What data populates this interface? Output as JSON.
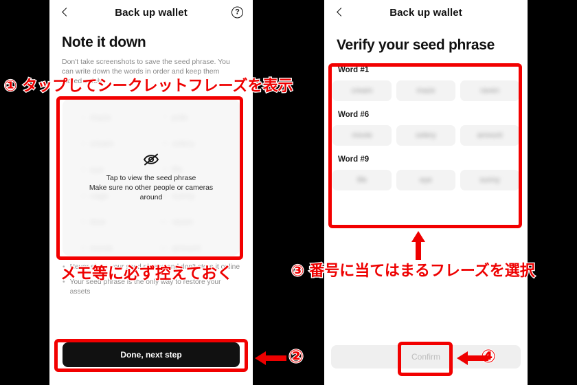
{
  "left_panel": {
    "nav": {
      "back_icon": "chevron-left-icon",
      "title": "Back up wallet",
      "help_icon": "question-circle-icon",
      "help_glyph": "?"
    },
    "title": "Note it down",
    "description": "Don't take screenshots to save the seed phrase. You can write down the words in order and keep them stored safely",
    "seed_overlay": {
      "icon": "eye-off-icon",
      "line1": "Tap to view the seed phrase",
      "line2": "Make sure no other people or cameras",
      "line3": "around"
    },
    "seed_words": [
      {
        "num": "1",
        "word": "maze"
      },
      {
        "num": "7",
        "word": "pole"
      },
      {
        "num": "2",
        "word": "cream"
      },
      {
        "num": "8",
        "word": "celery"
      },
      {
        "num": "3",
        "word": "eye"
      },
      {
        "num": "9",
        "word": "life"
      },
      {
        "num": "4",
        "word": "cage"
      },
      {
        "num": "10",
        "word": "sunny"
      },
      {
        "num": "5",
        "word": "blue"
      },
      {
        "num": "11",
        "word": "raven"
      },
      {
        "num": "6",
        "word": "movie"
      },
      {
        "num": "12",
        "word": "amount"
      }
    ],
    "bullets": [
      {
        "dot": "•",
        "text": "Never share your seed phrase and don't store it online"
      },
      {
        "dot": "•",
        "text": "Your seed phrase is the only way to restore your assets"
      }
    ],
    "primary_button": "Done, next step"
  },
  "right_panel": {
    "nav": {
      "back_icon": "chevron-left-icon",
      "title": "Back up wallet"
    },
    "title": "Verify your seed phrase",
    "groups": [
      {
        "label": "Word #1",
        "choices": [
          "cream",
          "maze",
          "raven"
        ]
      },
      {
        "label": "Word #6",
        "choices": [
          "movie",
          "celery",
          "amount"
        ]
      },
      {
        "label": "Word #9",
        "choices": [
          "life",
          "eye",
          "sunny"
        ]
      }
    ],
    "confirm_button": "Confirm"
  },
  "annotations": {
    "red": "#ee0000",
    "step1_text": "① タップしてシークレットフレーズを表示",
    "step1_note": "メモ等に必ず控えておく",
    "step2_marker": "②",
    "step3_text": "③ 番号に当てはまるフレーズを選択",
    "step4_marker": "④"
  }
}
